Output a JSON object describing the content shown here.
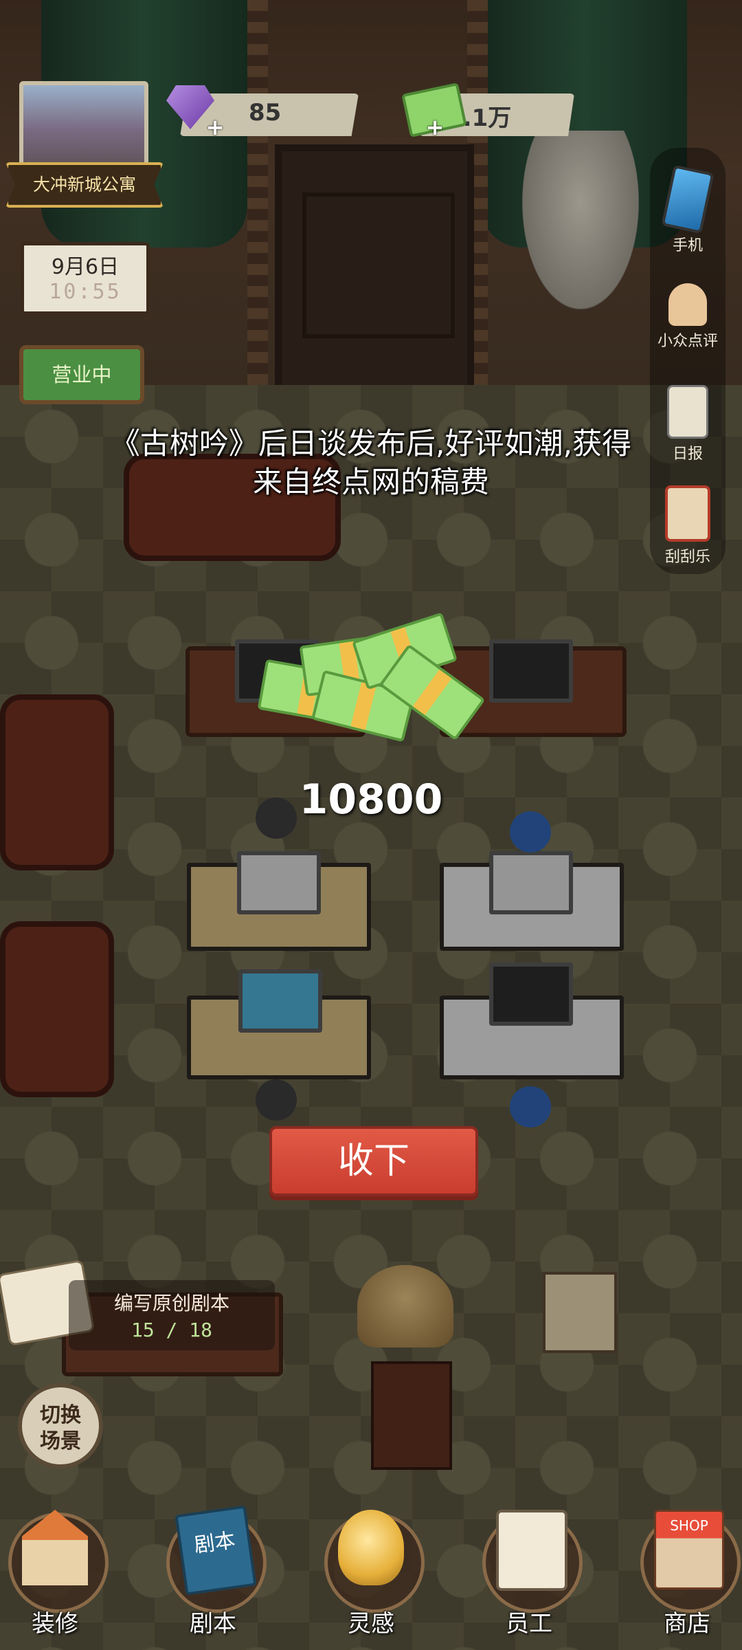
{
  "location": {
    "name": "大冲新城公寓"
  },
  "clock": {
    "date": "9月6日",
    "time": "10:55"
  },
  "status_sign": "营业中",
  "resources": {
    "gems": {
      "value": "85",
      "icon": "gem-icon"
    },
    "cash": {
      "value": "2.1万",
      "icon": "cash-icon"
    }
  },
  "side_menu": [
    {
      "label": "手机",
      "icon": "phone-icon"
    },
    {
      "label": "小众点评",
      "icon": "thumbs-up-icon"
    },
    {
      "label": "日报",
      "icon": "newspaper-icon"
    },
    {
      "label": "刮刮乐",
      "icon": "scratch-card-icon"
    }
  ],
  "reward_popup": {
    "message_line1": "《古树吟》后日谈发布后,好评如潮,获得",
    "message_line2": "来自终点网的稿费",
    "amount": "10800",
    "accept_label": "收下"
  },
  "task": {
    "title": "编写原创剧本",
    "progress": "15 / 18"
  },
  "switch_scene": {
    "line1": "切换",
    "line2": "场景"
  },
  "bottom_nav": [
    {
      "label": "装修",
      "icon": "house-icon"
    },
    {
      "label": "剧本",
      "icon": "script-book-icon",
      "glyph_text": "剧本"
    },
    {
      "label": "灵感",
      "icon": "lightbulb-icon"
    },
    {
      "label": "员工",
      "icon": "staff-badge-icon"
    },
    {
      "label": "商店",
      "icon": "shop-icon",
      "glyph_text": "SHOP"
    }
  ],
  "colors": {
    "accept_button": "#d84a3b",
    "open_sign": "#4b8f42",
    "progress_text": "#bfe39a"
  }
}
